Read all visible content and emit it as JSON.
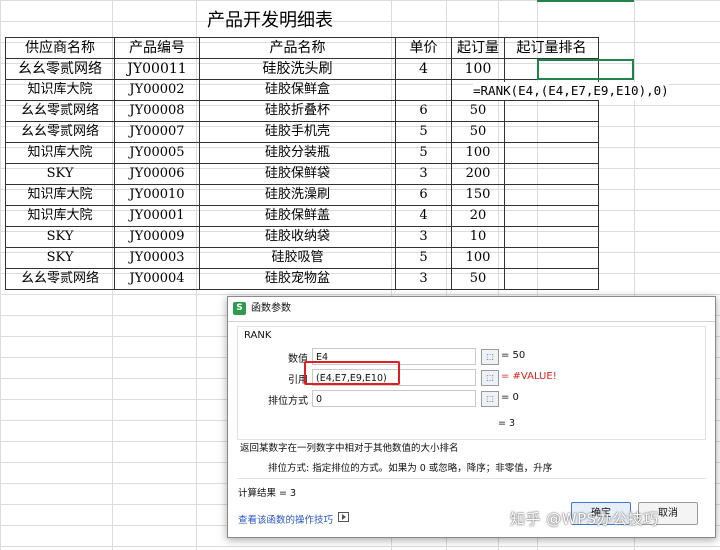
{
  "sheet": {
    "title": "产品开发明细表",
    "headers": [
      "供应商名称",
      "产品编号",
      "产品名称",
      "单价",
      "起订量",
      "起订量排名"
    ],
    "rows": [
      [
        "幺幺零贰网络",
        "JY00011",
        "硅胶洗头刷",
        "4",
        "100",
        ""
      ],
      [
        "知识库大院",
        "JY00002",
        "硅胶保鲜盒",
        "",
        "",
        ""
      ],
      [
        "幺幺零贰网络",
        "JY00008",
        "硅胶折叠杯",
        "6",
        "50",
        ""
      ],
      [
        "幺幺零贰网络",
        "JY00007",
        "硅胶手机壳",
        "5",
        "50",
        ""
      ],
      [
        "知识库大院",
        "JY00005",
        "硅胶分装瓶",
        "5",
        "100",
        ""
      ],
      [
        "SKY",
        "JY00006",
        "硅胶保鲜袋",
        "3",
        "200",
        ""
      ],
      [
        "知识库大院",
        "JY00010",
        "硅胶洗澡刷",
        "6",
        "150",
        ""
      ],
      [
        "知识库大院",
        "JY00001",
        "硅胶保鲜盖",
        "4",
        "20",
        ""
      ],
      [
        "SKY",
        "JY00009",
        "硅胶收纳袋",
        "3",
        "10",
        ""
      ],
      [
        "SKY",
        "JY00003",
        "硅胶吸管",
        "5",
        "100",
        ""
      ],
      [
        "幺幺零贰网络",
        "JY00004",
        "硅胶宠物盆",
        "3",
        "50",
        ""
      ]
    ],
    "formula_overlay": "=RANK(E4,(E4,E7,E9,E10),0)"
  },
  "dialog": {
    "title": "函数参数",
    "function_name": "RANK",
    "args": [
      {
        "label": "数值",
        "value": "E4",
        "result": "= 50"
      },
      {
        "label": "引用",
        "value": "(E4,E7,E9,E10)",
        "result": "= #VALUE!"
      },
      {
        "label": "排位方式",
        "value": "0",
        "result": "= 0"
      }
    ],
    "preview_result": "= 3",
    "description": "返回某数字在一列数字中相对于其他数值的大小排名",
    "param_help": "排位方式:  指定排位的方式。如果为 0 或忽略，降序；非零值，升序",
    "calc_result": "计算结果  =  3",
    "help_link": "查看该函数的操作技巧",
    "ok_label": "确定",
    "cancel_label": "取消"
  },
  "watermark": "知乎 @WPS办公技巧",
  "colors": {
    "selection": "#1e8449",
    "error": "#e02020",
    "link": "#2a55c7",
    "app_icon": "#2e9b4f"
  }
}
